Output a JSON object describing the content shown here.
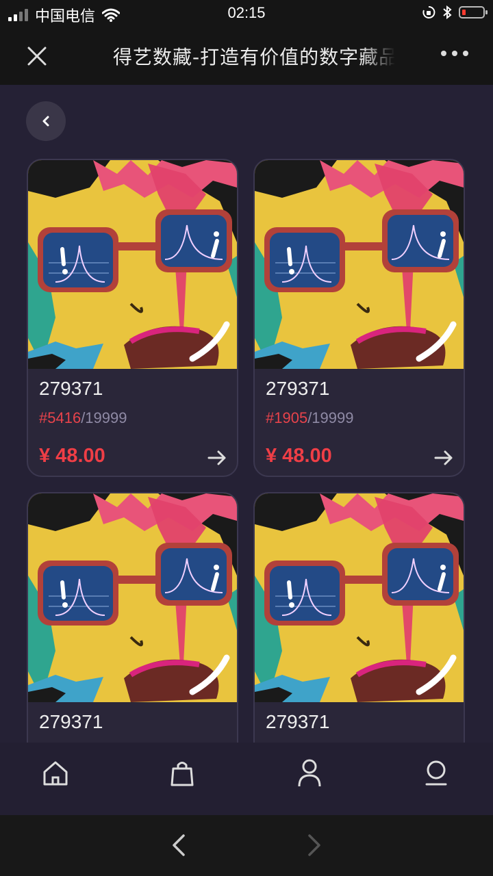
{
  "status_bar": {
    "carrier": "中国电信",
    "time": "02:15",
    "colors": {
      "battery_low": "#ff3b30"
    }
  },
  "title_bar": {
    "title": "得艺数藏-打造有价值的数字藏品平台",
    "icons": {
      "close": "close-icon",
      "more": "more-icon"
    }
  },
  "page": {
    "back_icon": "chevron-left-icon",
    "accent_color": "#ef3e46"
  },
  "cards": [
    {
      "name": "279371",
      "serial": "#5416",
      "total": "/19999",
      "price": "¥ 48.00"
    },
    {
      "name": "279371",
      "serial": "#1905",
      "total": "/19999",
      "price": "¥ 48.00"
    },
    {
      "name": "279371"
    },
    {
      "name": "279371"
    }
  ],
  "tab_bar": {
    "items": [
      {
        "icon": "home-icon"
      },
      {
        "icon": "bag-icon"
      },
      {
        "icon": "user-icon"
      },
      {
        "icon": "profile-icon"
      }
    ]
  },
  "browser_bar": {
    "icons": {
      "back": "chevron-left-icon",
      "forward": "chevron-right-icon"
    }
  }
}
